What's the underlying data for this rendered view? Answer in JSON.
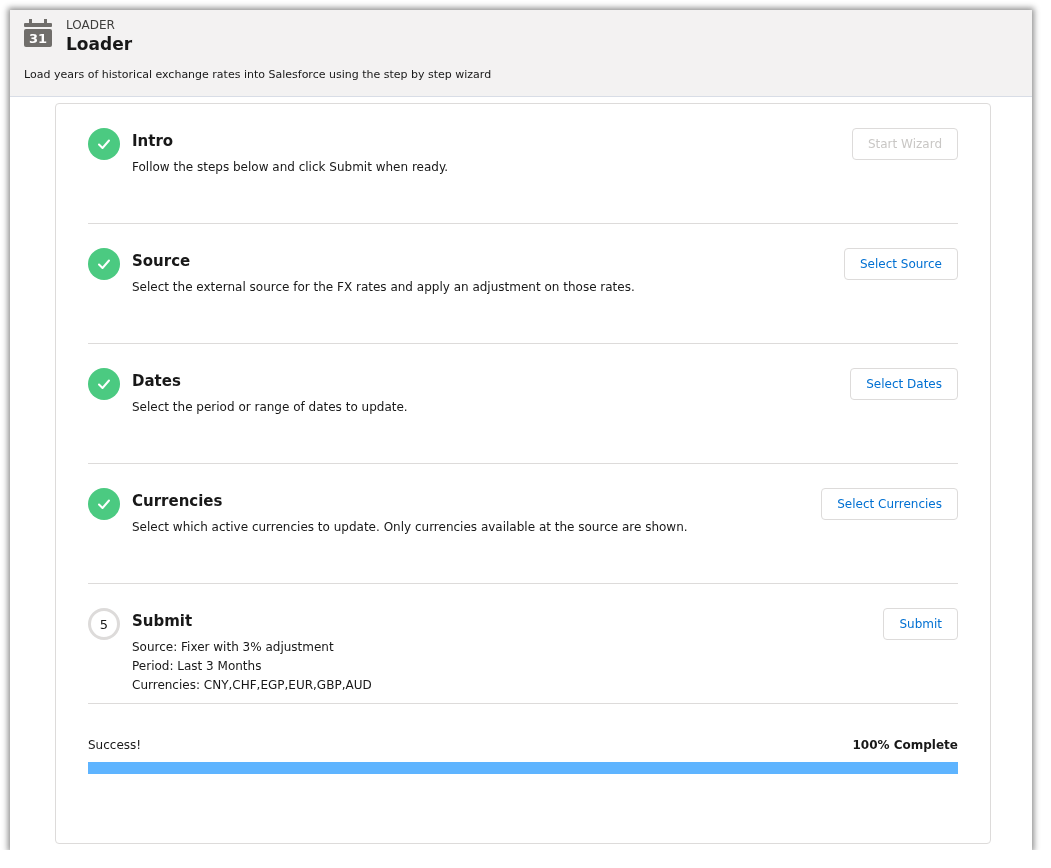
{
  "header": {
    "icon_text": "31",
    "eyebrow": "LOADER",
    "title": "Loader",
    "description": "Load years of historical exchange rates into Salesforce using the step by step wizard"
  },
  "steps": [
    {
      "title": "Intro",
      "done": true,
      "lines": [
        "Follow the steps below and click Submit when ready."
      ],
      "button": {
        "label": "Start Wizard",
        "disabled": true
      }
    },
    {
      "title": "Source",
      "done": true,
      "lines": [
        "Select the external source for the FX rates and apply an adjustment on those rates."
      ],
      "button": {
        "label": "Select Source",
        "disabled": false
      }
    },
    {
      "title": "Dates",
      "done": true,
      "lines": [
        "Select the period or range of dates to update."
      ],
      "button": {
        "label": "Select Dates",
        "disabled": false
      }
    },
    {
      "title": "Currencies",
      "done": true,
      "lines": [
        "Select which active currencies to update. Only currencies available at the source are shown."
      ],
      "button": {
        "label": "Select Currencies",
        "disabled": false
      }
    },
    {
      "title": "Submit",
      "done": false,
      "number": "5",
      "lines": [
        "Source: Fixer with 3% adjustment",
        "Period: Last 3 Months",
        "Currencies: CNY,CHF,EGP,EUR,GBP,AUD"
      ],
      "button": {
        "label": "Submit",
        "disabled": false
      }
    }
  ],
  "progress": {
    "status": "Success!",
    "label": "100% Complete",
    "level": 1
  }
}
